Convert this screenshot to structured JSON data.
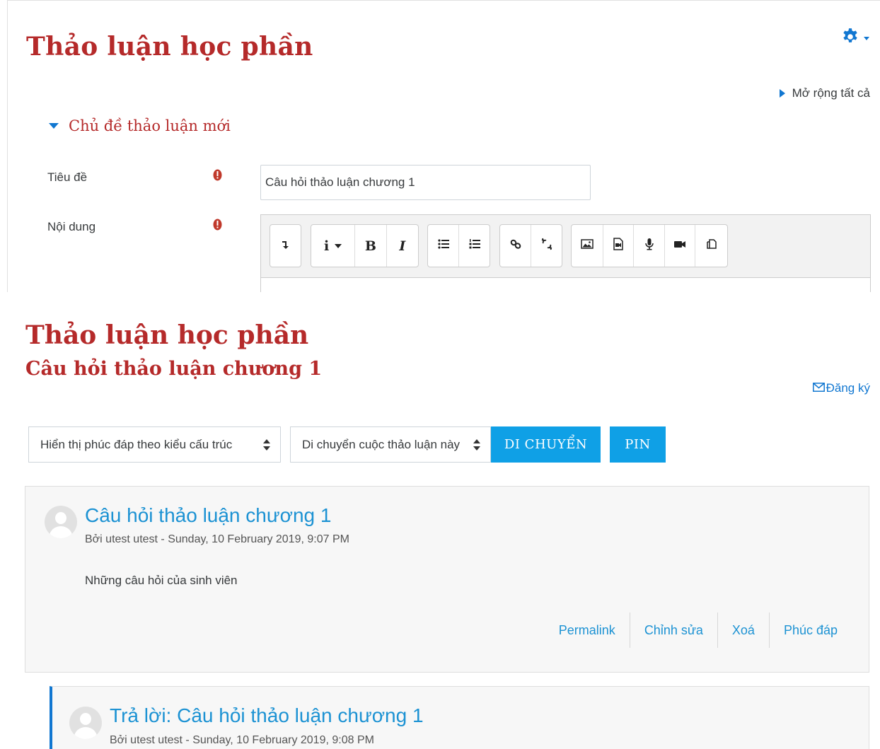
{
  "form_page": {
    "title": "Thảo luận học phần",
    "expand_all": "Mở rộng tất cả",
    "section_header": "Chủ đề thảo luận mới",
    "subject_label": "Tiêu đề",
    "subject_value": "Câu hỏi thảo luận chương 1",
    "message_label": "Nội dung",
    "toolbar_icons": [
      "show-more-icon",
      "paragraph-icon",
      "bold-icon",
      "italic-icon",
      "unordered-list-icon",
      "ordered-list-icon",
      "link-icon",
      "unlink-icon",
      "image-icon",
      "media-icon",
      "record-audio-icon",
      "record-video-icon",
      "manage-files-icon"
    ],
    "icon_color": "#1177d1",
    "required_color": "#c0392b"
  },
  "discussion_page": {
    "title": "Thảo luận học phần",
    "subtitle": "Câu hỏi thảo luận chương 1",
    "subscribe_label": "Đăng ký",
    "display_mode": "Hiển thị phúc đáp theo kiểu cấu trúc",
    "move_select": "Di chuyển cuộc thảo luận này",
    "move_button": "DI CHUYỂN",
    "pin_button": "PIN",
    "button_color": "#0fa0e6",
    "posts": [
      {
        "title": "Câu hỏi thảo luận chương 1",
        "byline": "Bởi utest utest - Sunday, 10 February 2019, 9:07 PM",
        "message": "Những câu hỏi của sinh viên",
        "commands": [
          "Permalink",
          "Chỉnh sửa",
          "Xoá",
          "Phúc đáp"
        ]
      },
      {
        "title": "Trả lời: Câu hỏi thảo luận chương 1",
        "byline": "Bởi utest utest - Sunday, 10 February 2019, 9:08 PM"
      }
    ]
  },
  "colors": {
    "heading": "#b52a2a",
    "link": "#1c92d3",
    "reply_border": "#1177d1"
  }
}
